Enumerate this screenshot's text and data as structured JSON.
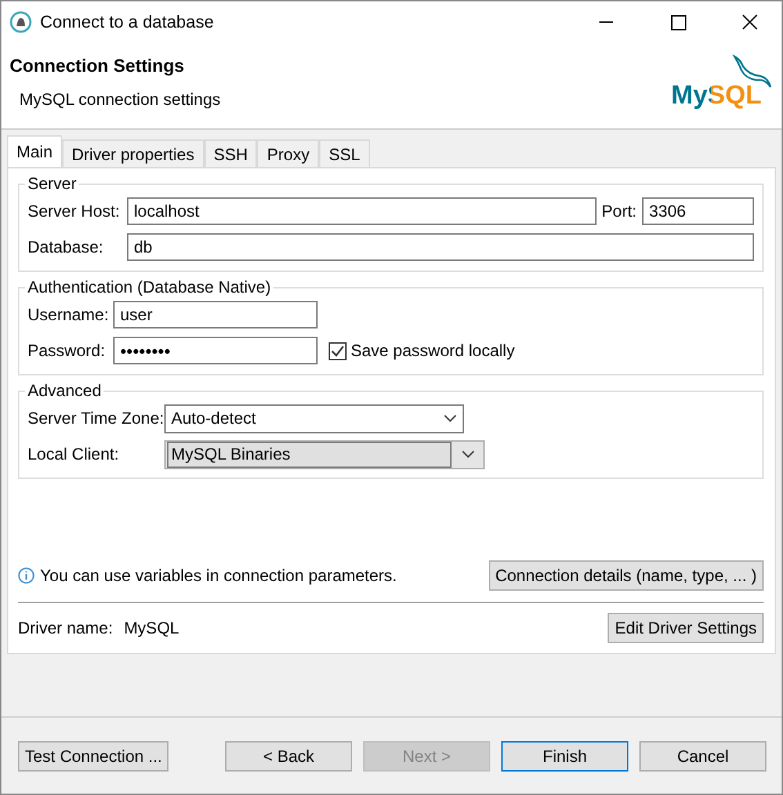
{
  "window": {
    "title": "Connect to a database"
  },
  "header": {
    "title": "Connection Settings",
    "subtitle": "MySQL connection settings",
    "logo": "MySQL"
  },
  "tabs": [
    {
      "label": "Main",
      "selected": true
    },
    {
      "label": "Driver properties",
      "selected": false
    },
    {
      "label": "SSH",
      "selected": false
    },
    {
      "label": "Proxy",
      "selected": false
    },
    {
      "label": "SSL",
      "selected": false
    }
  ],
  "server": {
    "legend": "Server",
    "host_label": "Server Host:",
    "host": "localhost",
    "port_label": "Port:",
    "port": "3306",
    "database_label": "Database:",
    "database": "db"
  },
  "auth": {
    "legend": "Authentication (Database Native)",
    "username_label": "Username:",
    "username": "user",
    "password_label": "Password:",
    "password": "••••••••",
    "save_label": "Save password locally",
    "save_checked": true
  },
  "advanced": {
    "legend": "Advanced",
    "timezone_label": "Server Time Zone:",
    "timezone": "Auto-detect",
    "client_label": "Local Client:",
    "client": "MySQL Binaries"
  },
  "info": "You can use variables in connection parameters.",
  "details_button": "Connection details (name, type, ... )",
  "driver": {
    "label": "Driver name:",
    "value": "MySQL",
    "button": "Edit Driver Settings"
  },
  "buttons": [
    {
      "label": "Test Connection ...",
      "kind": "left",
      "disabled": false,
      "default": false
    },
    {
      "label": "< Back",
      "kind": "nav",
      "disabled": false,
      "default": false
    },
    {
      "label": "Next >",
      "kind": "nav",
      "disabled": true,
      "default": false
    },
    {
      "label": "Finish",
      "kind": "nav",
      "disabled": false,
      "default": true
    },
    {
      "label": "Cancel",
      "kind": "nav",
      "disabled": false,
      "default": false
    }
  ]
}
